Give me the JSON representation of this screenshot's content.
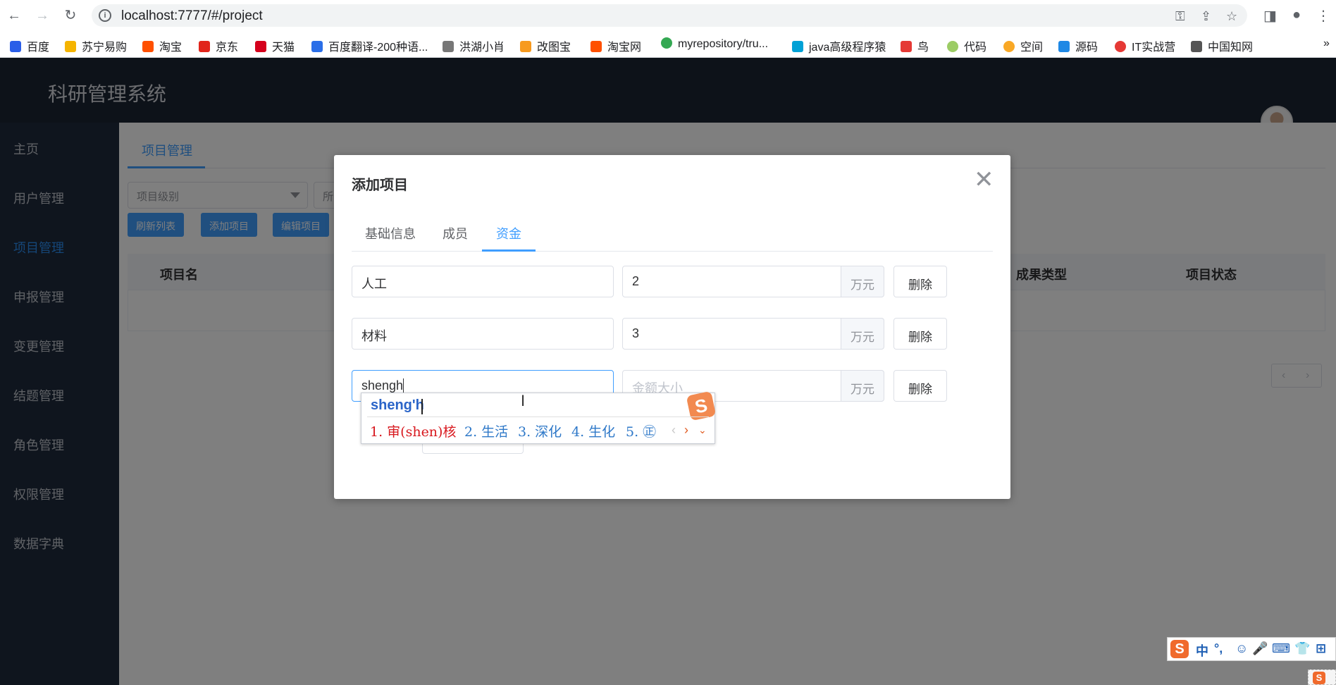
{
  "browser": {
    "url": "localhost:7777/#/project",
    "bookmarks": [
      {
        "label": "百度",
        "color": "#2a5ee8"
      },
      {
        "label": "苏宁易购",
        "color": "#f5b400"
      },
      {
        "label": "淘宝",
        "color": "#ff5000"
      },
      {
        "label": "京东",
        "color": "#e1251b"
      },
      {
        "label": "天猫",
        "color": "#d5001c"
      },
      {
        "label": "百度翻译-200种语...",
        "color": "#2a6ee8"
      },
      {
        "label": "洪湖小肖",
        "color": "#777777"
      },
      {
        "label": "改图宝",
        "color": "#f79a1e"
      },
      {
        "label": "淘宝网",
        "color": "#ff5000"
      },
      {
        "label": "myrepository/tru...",
        "color": "#34a853"
      },
      {
        "label": "java高级程序猿",
        "color": "#00a1d6"
      },
      {
        "label": "鸟",
        "color": "#e53935"
      },
      {
        "label": "代码",
        "color": "#9ccc65"
      },
      {
        "label": "空间",
        "color": "#f9a825"
      },
      {
        "label": "源码",
        "color": "#1e88e5"
      },
      {
        "label": "IT实战营",
        "color": "#e53935"
      },
      {
        "label": "中国知网",
        "color": "#555555"
      }
    ],
    "more": "»"
  },
  "app": {
    "title": "科研管理系统",
    "sidebar": [
      "主页",
      "用户管理",
      "项目管理",
      "申报管理",
      "变更管理",
      "结题管理",
      "角色管理",
      "权限管理",
      "数据字典"
    ],
    "active_index": 2,
    "main_tab": "项目管理",
    "filter_level_placeholder": "项目级别",
    "filter_second_placeholder": "所",
    "buttons": [
      "刷新列表",
      "添加项目",
      "编辑项目"
    ],
    "table_headers": {
      "name": "项目名",
      "result_type": "成果类型",
      "status": "项目状态"
    }
  },
  "dialog": {
    "title": "添加项目",
    "close": "✕",
    "tabs": [
      "基础信息",
      "成员",
      "资金"
    ],
    "active_tab": 2,
    "funds": [
      {
        "name": "人工",
        "amount": "2",
        "amount_placeholder": "",
        "unit": "万元",
        "delete": "删除"
      },
      {
        "name": "材料",
        "amount": "3",
        "amount_placeholder": "",
        "unit": "万元",
        "delete": "删除"
      },
      {
        "name": "shengh",
        "amount": "",
        "amount_placeholder": "金额大小",
        "unit": "万元",
        "delete": "删除"
      }
    ]
  },
  "ime": {
    "pinyin": "sheng'h",
    "candidates": [
      "1. 审(shen)核",
      "2. 生活",
      "3. 深化",
      "4. 生化",
      "5. ㊣"
    ],
    "toolbar": [
      "中",
      "°,",
      "☺",
      "🎤",
      "⌨",
      "👕",
      "⊞"
    ]
  }
}
